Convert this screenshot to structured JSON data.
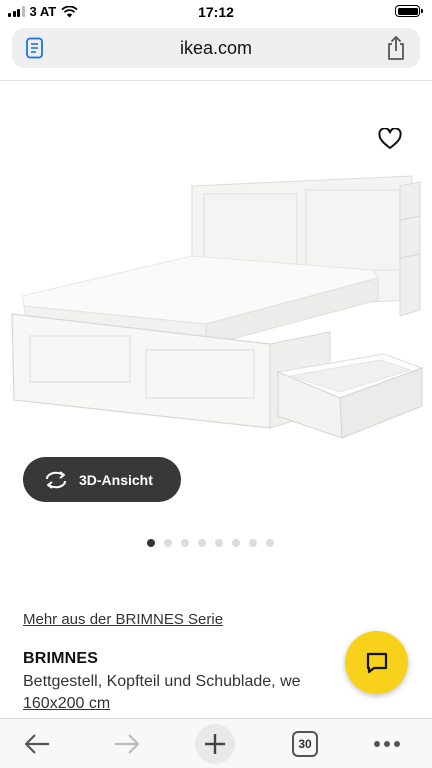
{
  "status_bar": {
    "carrier": "3 AT",
    "time": "17:12"
  },
  "browser": {
    "url": "ikea.com",
    "tab_count": "30"
  },
  "product": {
    "view_3d_label": "3D-Ansicht",
    "image_count": 8,
    "active_image_index": 0,
    "series_link": "Mehr aus der BRIMNES Serie",
    "name": "BRIMNES",
    "description": "Bettgestell, Kopfteil und Schublade, we",
    "size": "160x200 cm"
  },
  "icons": {
    "reader": "reader-mode-icon",
    "share": "share-icon",
    "favorite": "heart-icon",
    "rotate": "rotate-3d-icon",
    "chat": "chat-icon",
    "back": "back-arrow-icon",
    "forward": "forward-arrow-icon",
    "new_tab": "plus-icon",
    "more": "more-dots-icon"
  },
  "colors": {
    "chat_button": "#f7d11a",
    "view3d_button": "#383838"
  }
}
